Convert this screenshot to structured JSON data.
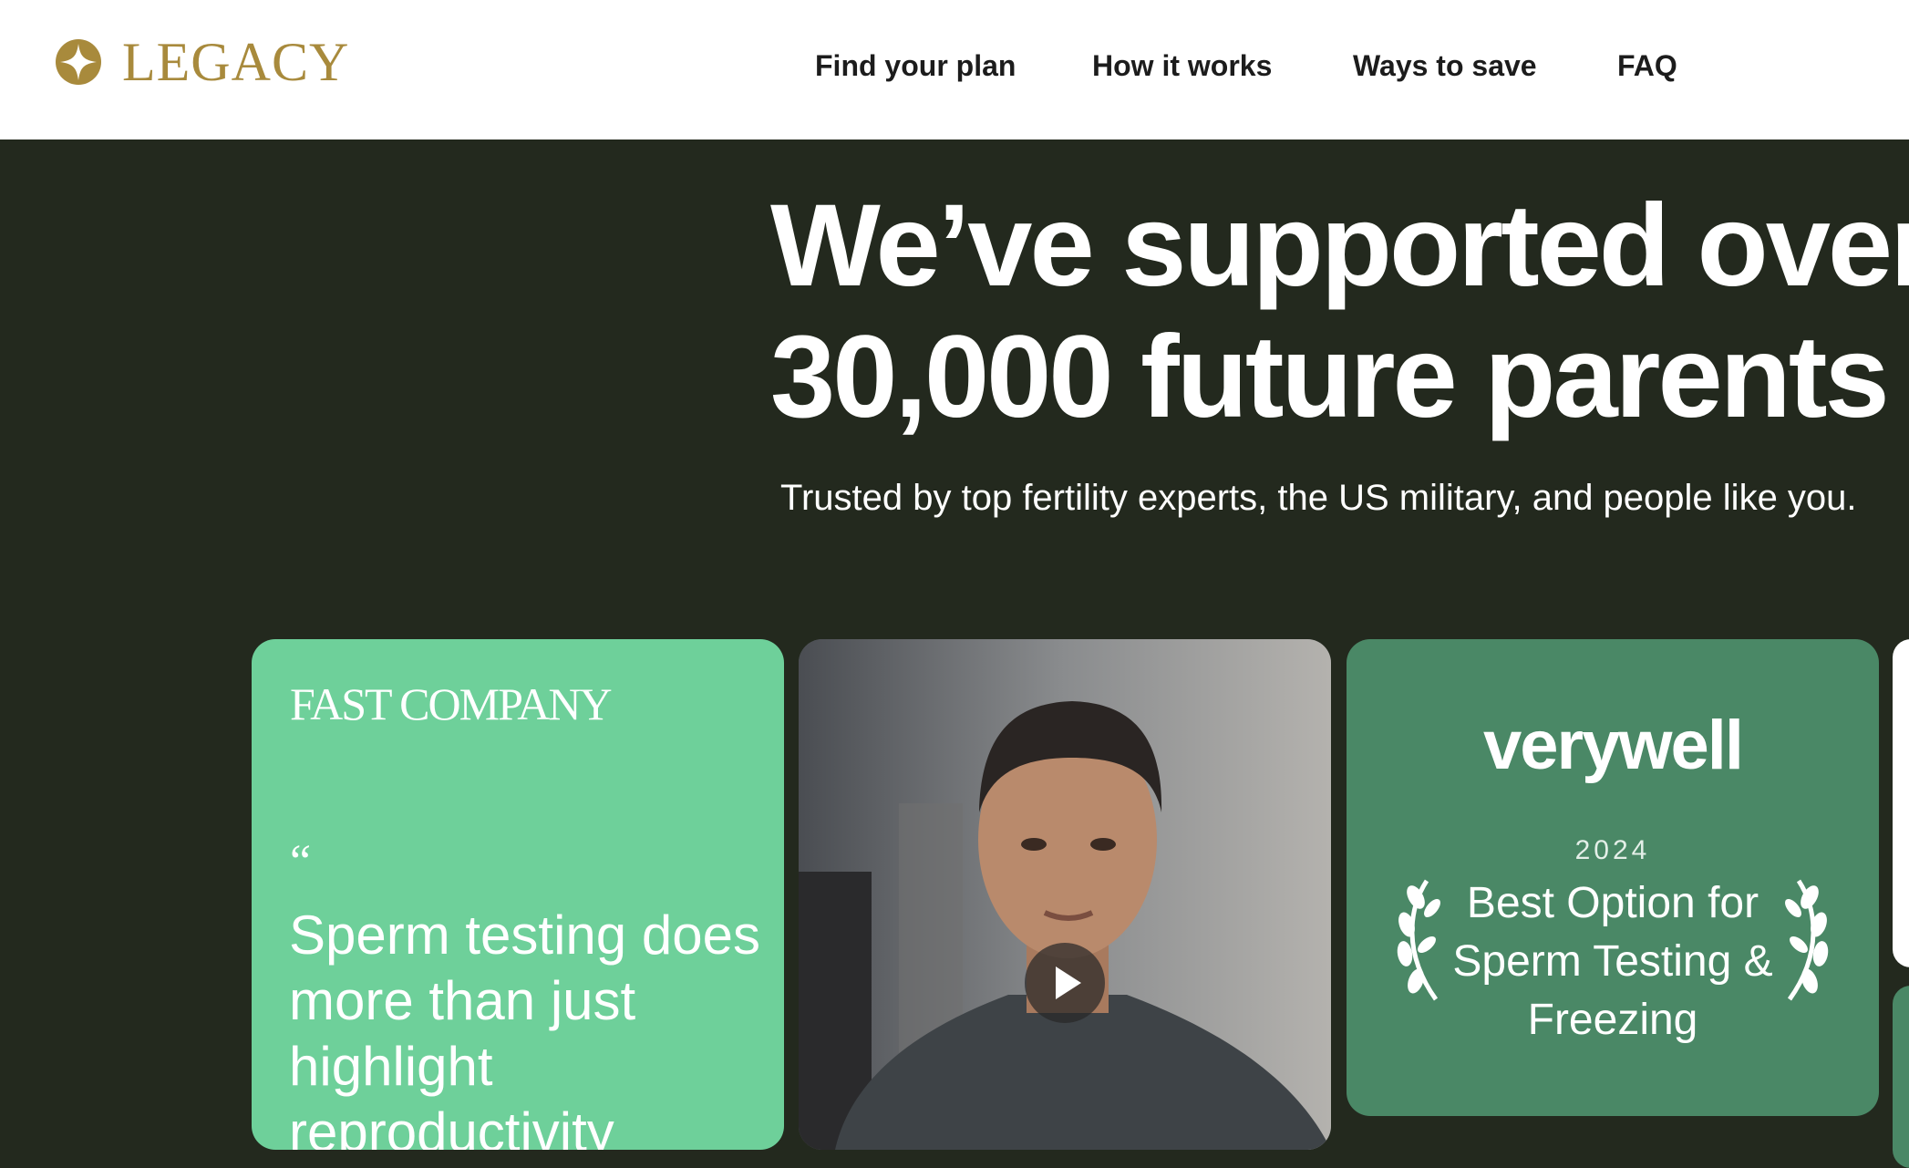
{
  "header": {
    "logo_text": "LEGACY",
    "nav": [
      "Find your plan",
      "How it works",
      "Ways to save",
      "FAQ"
    ]
  },
  "hero": {
    "title_line1": "We’ve supported over",
    "title_line2": "30,000 future parents",
    "subtitle": "Trusted by top fertility experts, the US military, and people like you."
  },
  "cards": {
    "fast_company": {
      "logo": "FAST COMPANY",
      "quote_mark": "“",
      "quote": "Sperm testing does more than just highlight reproductivity"
    },
    "video": {
      "play_icon": "play-icon"
    },
    "verywell": {
      "logo": "verywell",
      "year": "2024",
      "award": "Best Option for Sperm Testing & Freezing"
    }
  },
  "colors": {
    "brand_gold": "#a88a3c",
    "hero_bg": "#23291e",
    "card_mint": "#6ed09a",
    "card_green": "#4a8866"
  }
}
